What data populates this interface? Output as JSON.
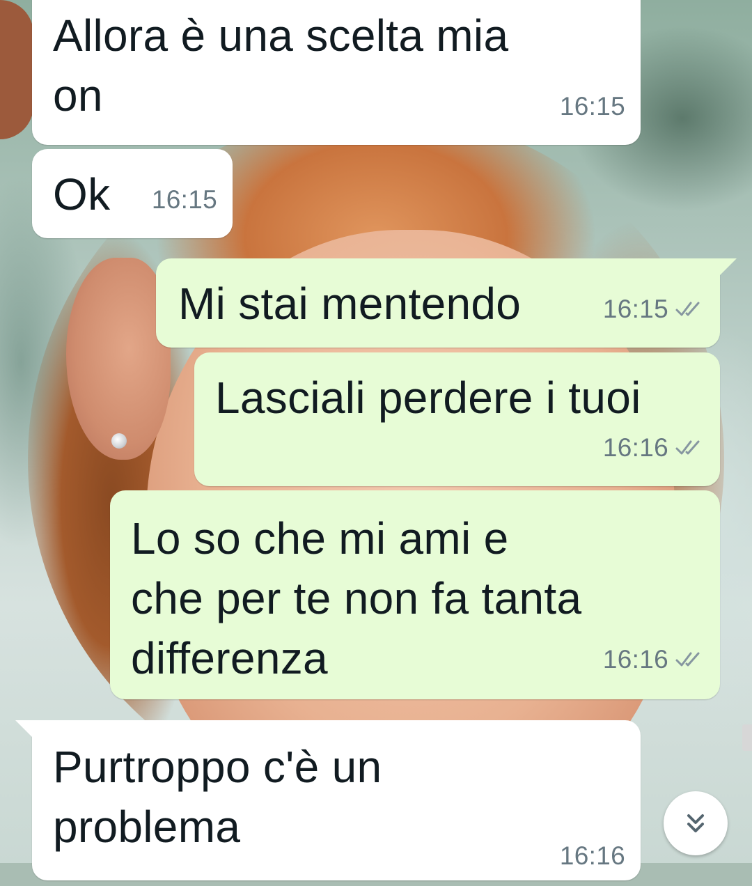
{
  "messages": [
    {
      "direction": "incoming",
      "text": "Allora è una scelta mia\non",
      "time": "16:15"
    },
    {
      "direction": "incoming",
      "text": "Ok",
      "time": "16:15"
    },
    {
      "direction": "outgoing",
      "text": "Mi stai mentendo",
      "time": "16:15",
      "status": "read"
    },
    {
      "direction": "outgoing",
      "text": "Lasciali perdere i tuoi",
      "time": "16:16",
      "status": "read"
    },
    {
      "direction": "outgoing",
      "text": "Lo so che mi ami e\nche per te non fa tanta\ndifferenza",
      "time": "16:16",
      "status": "read"
    },
    {
      "direction": "incoming",
      "text": "Purtroppo c'è un\nproblema",
      "time": "16:16"
    }
  ],
  "icons": {
    "status_tick": "double-check-icon",
    "scroll_button": "chevron-double-down-icon"
  },
  "colors": {
    "incoming_bubble": "#ffffff",
    "outgoing_bubble": "#e7fcd6",
    "text": "#111b21",
    "meta": "#667781",
    "tick": "#8696a0"
  }
}
